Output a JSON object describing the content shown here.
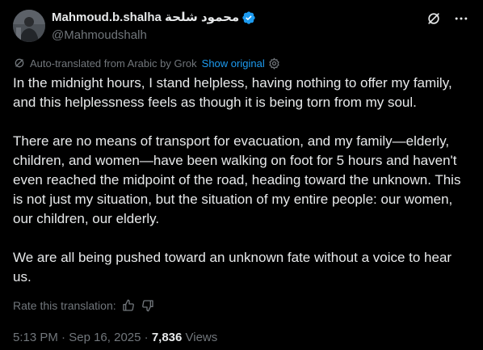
{
  "author": {
    "display_name": "Mahmoud.b.shalha محمود شلحة",
    "handle": "@Mahmoudshalh",
    "verified": true,
    "verified_color": "#1d9bf0"
  },
  "icons": {
    "grok": "grok-icon",
    "more": "more-icon",
    "translate": "translate-icon",
    "settings": "gear-icon",
    "like": "thumbs-up-icon",
    "dislike": "thumbs-down-icon"
  },
  "translation": {
    "notice": "Auto-translated from Arabic by Grok",
    "show_original": "Show original"
  },
  "tweet": {
    "paragraphs": [
      "In the midnight hours, I stand helpless, having nothing to offer my family, and this helplessness feels as though it is being torn from my soul.",
      "There are no means of transport for evacuation, and my family—elderly, children, and women—have been walking on foot for 5 hours and haven't even reached the midpoint of the road, heading toward the unknown. This is not just my situation, but the situation of my entire people: our women, our children, our elderly.",
      "We are all being pushed toward an unknown fate without a voice to hear us."
    ]
  },
  "rating": {
    "label": "Rate this translation:"
  },
  "meta": {
    "time": "5:13 PM",
    "separator": " · ",
    "date": "Sep 16, 2025",
    "views_count": "7,836",
    "views_label": " Views"
  },
  "colors": {
    "background": "#000000",
    "text": "#e7e9ea",
    "secondary": "#71767b",
    "accent": "#1d9bf0"
  }
}
